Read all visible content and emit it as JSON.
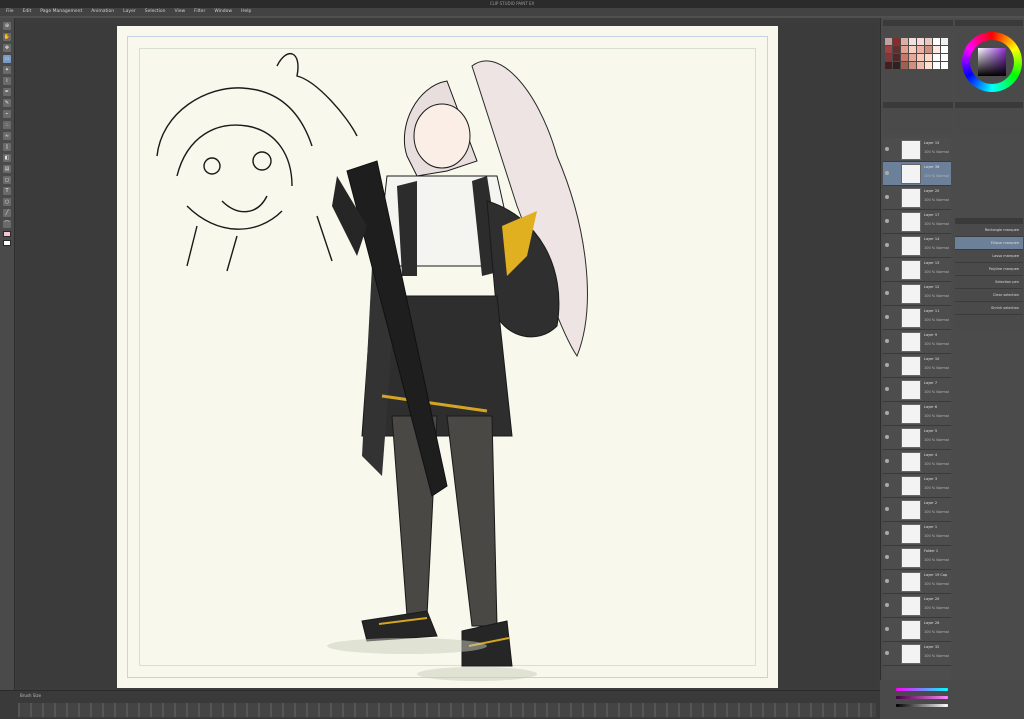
{
  "app": {
    "title": "CLIP STUDIO PAINT EX"
  },
  "menu": [
    "File",
    "Edit",
    "Page Management",
    "Animation",
    "Layer",
    "Selection",
    "View",
    "Filter",
    "Window",
    "Help"
  ],
  "toolbox": {
    "tools": [
      "zoom-icon",
      "hand-icon",
      "move-icon",
      "selection-icon",
      "auto-select-icon",
      "eyedropper-icon",
      "pen-icon",
      "pencil-icon",
      "brush-icon",
      "airbrush-icon",
      "blend-icon",
      "eraser-icon",
      "fill-icon",
      "gradient-icon",
      "figure-icon",
      "text-icon",
      "balloon-icon",
      "ruler-icon",
      "correct-line-icon"
    ]
  },
  "color_set": {
    "swatches": [
      "#c0a0a0",
      "#8a2a2a",
      "#d8b0a8",
      "#f0e0e0",
      "#f8d8d8",
      "#e8c8c0",
      "#ffffff",
      "#f0f0f0",
      "#a04040",
      "#603030",
      "#e0a090",
      "#f8d0c0",
      "#f0b0a0",
      "#d09080",
      "#ffe8e0",
      "#ffffff",
      "#803838",
      "#502828",
      "#c87868",
      "#e8a898",
      "#f8c8b8",
      "#ffd8c8",
      "#ffffff",
      "#ffffff",
      "#402020",
      "#302020",
      "#a06050",
      "#d09080",
      "#f0b8a8",
      "#ffe0d0",
      "#ffffff",
      "#ffffff"
    ]
  },
  "color_wheel": {
    "accent": "#8c2fd6"
  },
  "layers": [
    {
      "name": "Layer 15",
      "mode": "100 % Normal"
    },
    {
      "name": "Layer 36",
      "mode": "100 % Normal"
    },
    {
      "name": "Layer 20",
      "mode": "100 % Normal"
    },
    {
      "name": "Layer 17",
      "mode": "100 % Normal"
    },
    {
      "name": "Layer 14",
      "mode": "100 % Normal"
    },
    {
      "name": "Layer 13",
      "mode": "100 % Normal"
    },
    {
      "name": "Layer 12",
      "mode": "100 % Normal"
    },
    {
      "name": "Layer 11",
      "mode": "100 % Normal"
    },
    {
      "name": "Layer 9",
      "mode": "100 % Normal"
    },
    {
      "name": "Layer 10",
      "mode": "100 % Normal"
    },
    {
      "name": "Layer 7",
      "mode": "100 % Normal"
    },
    {
      "name": "Layer 6",
      "mode": "100 % Normal"
    },
    {
      "name": "Layer 5",
      "mode": "100 % Normal"
    },
    {
      "name": "Layer 4",
      "mode": "100 % Normal"
    },
    {
      "name": "Layer 3",
      "mode": "100 % Normal"
    },
    {
      "name": "Layer 2",
      "mode": "100 % Normal"
    },
    {
      "name": "Layer 1",
      "mode": "100 % Normal"
    },
    {
      "name": "Folder 1",
      "mode": "100 % Normal"
    },
    {
      "name": "Layer 19 Cop",
      "mode": "100 % Normal"
    },
    {
      "name": "Layer 20",
      "mode": "100 % Normal"
    },
    {
      "name": "Layer 26",
      "mode": "100 % Normal"
    },
    {
      "name": "Layer 32",
      "mode": "100 % Normal"
    }
  ],
  "sub_tools": [
    "Rectangle marquee",
    "Ellipse marquee",
    "Lasso marquee",
    "Polyline marquee",
    "Selection pen",
    "Clear selection",
    "Shrink selection"
  ],
  "status": {
    "zoom": "Brush Size"
  }
}
